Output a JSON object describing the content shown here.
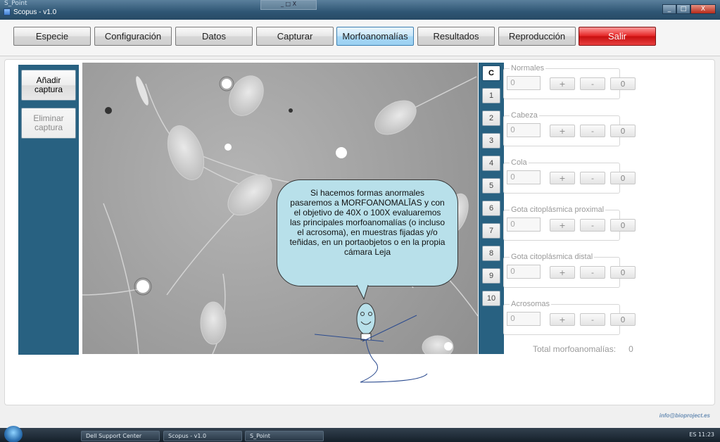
{
  "window": {
    "ghost_title": "S_Point",
    "title": "Scopus - v1.0",
    "ghost_window_label": "_ □ X",
    "minimize": "_",
    "maximize": "□",
    "close": "X"
  },
  "tabs": [
    {
      "label": "Especie"
    },
    {
      "label": "Configuración"
    },
    {
      "label": "Datos"
    },
    {
      "label": "Capturar"
    },
    {
      "label": "Morfoanomalías"
    },
    {
      "label": "Resultados"
    },
    {
      "label": "Reproducción"
    },
    {
      "label": "Salir"
    }
  ],
  "sidebar": {
    "add_capture": "Añadir captura",
    "delete_capture": "Eliminar captura"
  },
  "captures": [
    "C",
    "1",
    "2",
    "3",
    "4",
    "5",
    "6",
    "7",
    "8",
    "9",
    "10"
  ],
  "counters": [
    {
      "label": "Normales",
      "value": "0",
      "plus": "+",
      "minus": "-",
      "reset": "0"
    },
    {
      "label": "Cabeza",
      "value": "0",
      "plus": "+",
      "minus": "-",
      "reset": "0"
    },
    {
      "label": "Cola",
      "value": "0",
      "plus": "+",
      "minus": "-",
      "reset": "0"
    },
    {
      "label": "Gota citoplásmica proximal",
      "value": "0",
      "plus": "+",
      "minus": "-",
      "reset": "0"
    },
    {
      "label": "Gota citoplásmica distal",
      "value": "0",
      "plus": "+",
      "minus": "-",
      "reset": "0"
    },
    {
      "label": "Acrosomas",
      "value": "0",
      "plus": "+",
      "minus": "-",
      "reset": "0"
    }
  ],
  "total": {
    "label": "Total morfoanomalías:",
    "value": "0"
  },
  "bubble_text": "Si hacemos formas anormales pasaremos a MORFOANOMALĪAS y con el objetivo de 40X o 100X evaluaremos las principales morfoanomalías (o incluso el acrosoma), en muestras fijadas y/o teñidas, en un portaobjetos o en la propia cámara Leja",
  "email": "info@bioproject.es",
  "taskbar": {
    "items": [
      "Dell Support Center",
      "Scopus - v1.0",
      "S_Point"
    ],
    "tray": "ES   11:23"
  }
}
